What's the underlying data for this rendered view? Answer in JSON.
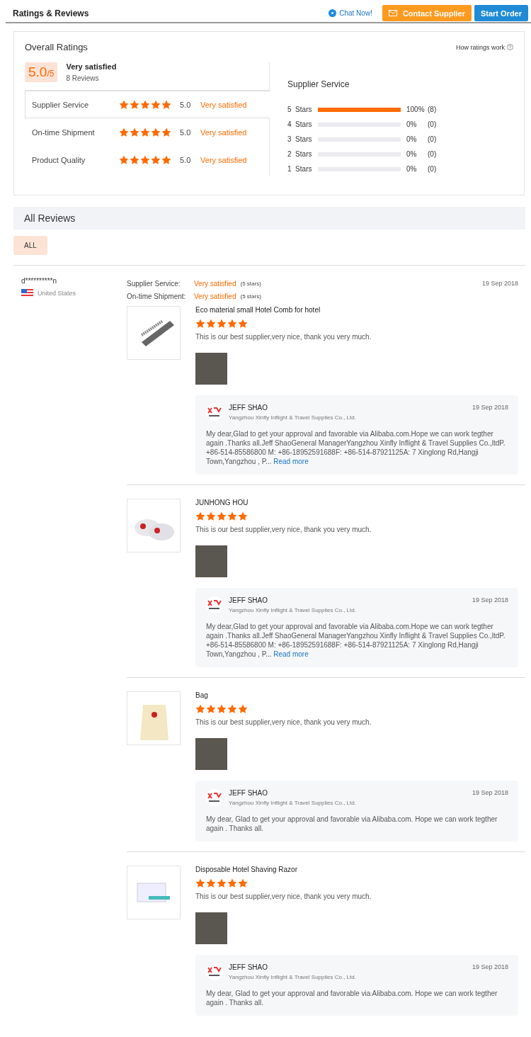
{
  "header": {
    "title": "Ratings & Reviews",
    "chat": "Chat Now!",
    "contact": "Contact Supplier",
    "order": "Start Order"
  },
  "overall": {
    "title": "Overall Ratings",
    "how": "How ratings work",
    "score": "5.0",
    "out_of": "/5",
    "verdict": "Very satisfied",
    "count": "8 Reviews",
    "categories": [
      {
        "name": "Supplier Service",
        "stars": 5,
        "score": "5.0",
        "verdict": "Very satisfied",
        "selected": true
      },
      {
        "name": "On-time Shipment",
        "stars": 5,
        "score": "5.0",
        "verdict": "Very satisfied",
        "selected": false
      },
      {
        "name": "Product Quality",
        "stars": 5,
        "score": "5.0",
        "verdict": "Very satisfied",
        "selected": false
      }
    ],
    "breakdown_title": "Supplier Service",
    "breakdown": [
      {
        "label": "5  Stars",
        "level": 1,
        "percent": "100%",
        "count": "(8)"
      },
      {
        "label": "4  Stars",
        "level": 0,
        "percent": "0%",
        "count": "(0)"
      },
      {
        "label": "3  Stars",
        "level": 0,
        "percent": "0%",
        "count": "(0)"
      },
      {
        "label": "2  Stars",
        "level": 0,
        "percent": "0%",
        "count": "(0)"
      },
      {
        "label": "1  Stars",
        "level": 0,
        "percent": "0%",
        "count": "(0)"
      }
    ]
  },
  "all_reviews": {
    "title": "All Reviews",
    "filters": [
      {
        "label": "ALL",
        "selected": true
      }
    ]
  },
  "review": {
    "user": "d**********n",
    "country": "United States",
    "date": "19 Sep 2018",
    "ratings": [
      {
        "label": "Supplier Service:",
        "verdict": "Very satisfied",
        "stars_text": "(5 stars)"
      },
      {
        "label": "On-time Shipment:",
        "verdict": "Very satisfied",
        "stars_text": "(5 stars)"
      }
    ],
    "items": [
      {
        "product": "Eco material small Hotel Comb for hotel",
        "kind": "comb",
        "stars": 5,
        "comment": "This is our best supplier,very nice, thank you very much.",
        "reply": {
          "name": "JEFF SHAO",
          "company": "Yangzhou Xinfly Inflight & Travel Supplies Co., Ltd.",
          "date": "19 Sep 2018",
          "text": "My dear,Glad to get your approval and favorable via Alibaba.com.Hope we can work tegther again .Thanks all.Jeff ShaoGeneral ManagerYangzhou Xinfly Inflight & Travel Supplies Co.,ltdP. +86-514-85586800 M: +86-18952591688F: +86-514-87921125A: 7 Xinglong Rd,Hangji Town,Yangzhou , P...",
          "read_more": "Read more"
        }
      },
      {
        "product": "JUNHONG HOU",
        "kind": "slippers",
        "stars": 5,
        "comment": "This is our best supplier,very nice, thank you very much.",
        "reply": {
          "name": "JEFF SHAO",
          "company": "Yangzhou Xinfly Inflight & Travel Supplies Co., Ltd.",
          "date": "19 Sep 2018",
          "text": "My dear,Glad to get your approval and favorable via Alibaba.com.Hope we can work tegther again .Thanks all.Jeff ShaoGeneral ManagerYangzhou Xinfly Inflight & Travel Supplies Co.,ltdP. +86-514-85586800 M: +86-18952591688F: +86-514-87921125A: 7 Xinglong Rd,Hangji Town,Yangzhou , P...",
          "read_more": "Read more"
        }
      },
      {
        "product": "Bag",
        "kind": "bag",
        "stars": 5,
        "comment": "This is our best supplier,very nice, thank you very much.",
        "reply": {
          "name": "JEFF SHAO",
          "company": "Yangzhou Xinfly Inflight & Travel Supplies Co., Ltd.",
          "date": "19 Sep 2018",
          "text": "My dear, Glad to get your approval and favorable via Alibaba.com. Hope we can work tegther again . Thanks all."
        }
      },
      {
        "product": "Disposable Hotel Shaving Razor",
        "kind": "razor",
        "stars": 5,
        "comment": "This is our best supplier,very nice, thank you very much.",
        "reply": {
          "name": "JEFF SHAO",
          "company": "Yangzhou Xinfly Inflight & Travel Supplies Co., Ltd.",
          "date": "19 Sep 2018",
          "text": "My dear, Glad to get your approval and favorable via Alibaba.com. Hope we can work tegther again . Thanks all."
        }
      }
    ]
  }
}
